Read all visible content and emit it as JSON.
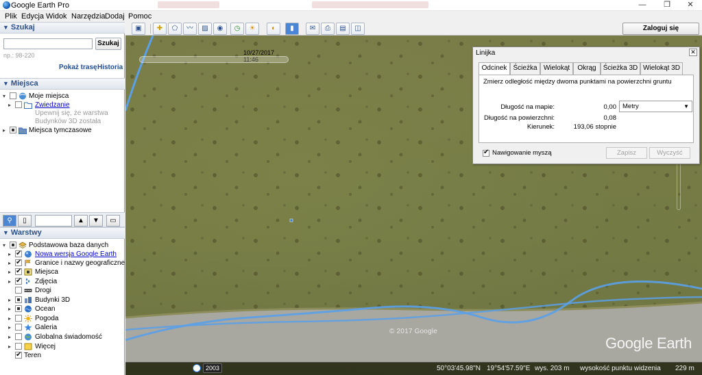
{
  "window": {
    "title": "Google Earth Pro"
  },
  "menu": [
    "Plik",
    "Edycja",
    "Widok",
    "Narzędzia",
    "Dodaj",
    "Pomoc"
  ],
  "search": {
    "header": "Szukaj",
    "placeholder": "",
    "button": "Szukaj",
    "hint": "np.: 98-220",
    "route_link": "Pokaż trasę",
    "history_link": "Historia"
  },
  "places": {
    "header": "Miejsca",
    "items": [
      {
        "label": "Moje miejsca"
      },
      {
        "label": "Zwiedzanie"
      },
      {
        "label": "Upewnij się, że warstwa"
      },
      {
        "label": "Budynków 3D została"
      },
      {
        "label": "Miejsca tymczasowe"
      }
    ]
  },
  "layers": {
    "header": "Warstwy",
    "items": [
      {
        "label": "Podstawowa baza danych"
      },
      {
        "label": "Nowa wersja Google Earth"
      },
      {
        "label": "Granice i nazwy geograficzne"
      },
      {
        "label": "Miejsca"
      },
      {
        "label": "Zdjęcia"
      },
      {
        "label": "Drogi"
      },
      {
        "label": "Budynki 3D"
      },
      {
        "label": "Ocean"
      },
      {
        "label": "Pogoda"
      },
      {
        "label": "Galeria"
      },
      {
        "label": "Globalna świadomość"
      },
      {
        "label": "Więcej"
      },
      {
        "label": "Teren"
      }
    ]
  },
  "toolbar": {
    "login": "Zaloguj się"
  },
  "map": {
    "date": "10/27/2017  11:46",
    "copyright": "© 2017 Google",
    "logo": "Google Earth",
    "status": {
      "year": "2003",
      "lat": "50°03'45.98\"N",
      "lon": "19°54'57.59\"E",
      "elevation": "wys.  203 m",
      "eye_alt_label": "wysokość punktu widzenia",
      "eye_alt": "229 m"
    }
  },
  "ruler": {
    "title": "Linijka",
    "tabs": [
      "Odcinek",
      "Ścieżka",
      "Wielokąt",
      "Okrąg",
      "Ścieżka 3D",
      "Wielokąt 3D"
    ],
    "description": "Zmierz odległość między dwoma punktami na powierzchni gruntu",
    "map_length_label": "Długość na mapie:",
    "map_length_value": "0,00",
    "unit": "Metry",
    "ground_length_label": "Długość na powierzchni:",
    "ground_length_value": "0,08",
    "heading_label": "Kierunek:",
    "heading_value": "193,06 stopnie",
    "mouse_nav": "Nawigowanie myszą",
    "save": "Zapisz",
    "clear": "Wyczyść"
  }
}
